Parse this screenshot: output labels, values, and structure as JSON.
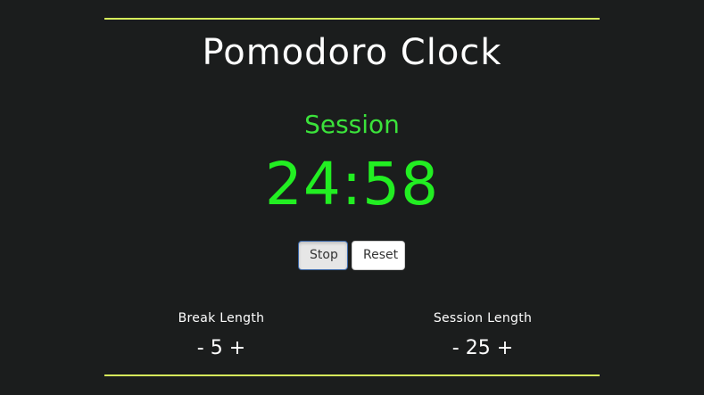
{
  "app": {
    "title": "Pomodoro Clock"
  },
  "timer": {
    "mode": "Session",
    "time": "24:58"
  },
  "controls": {
    "stop_label": "Stop",
    "reset_label": "Reset"
  },
  "break_length": {
    "label": "Break Length",
    "decrement": "-",
    "value": "5",
    "increment": "+"
  },
  "session_length": {
    "label": "Session Length",
    "decrement": "-",
    "value": "25",
    "increment": "+"
  },
  "colors": {
    "background": "#1b1d1d",
    "accent_rule": "#d6ee5b",
    "timer_green": "#22ee22",
    "text": "#ffffff"
  }
}
